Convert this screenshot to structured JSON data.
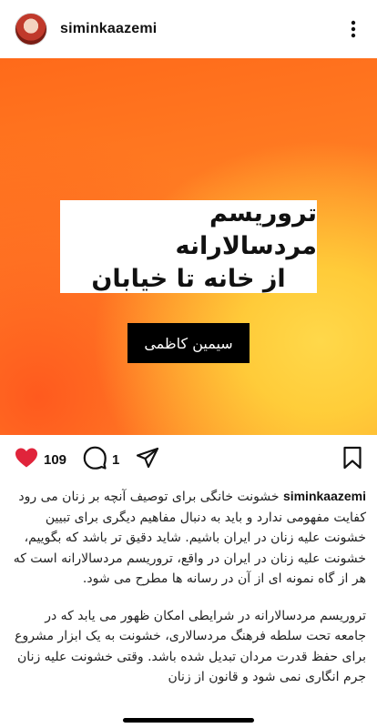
{
  "header": {
    "username": "siminkaazemi",
    "more_icon": "more-vertical-icon"
  },
  "post_image": {
    "title_line1": "تروریسم مردسالارانه",
    "title_line2": "از خانه تا خیابان",
    "author": "سیمین کاظمی"
  },
  "actions": {
    "likes": "109",
    "comments": "1",
    "icons": [
      "heart-icon",
      "comment-icon",
      "share-icon",
      "bookmark-icon"
    ],
    "heart_color": "#e0243b"
  },
  "caption": {
    "username": "siminkaazemi",
    "paragraph1_text": "خشونت خانگی برای توصیف آنچه بر زنان می رود کفایت مفهومی ندارد و باید به دنبال مفاهیم دیگری برای تبیین خشونت علیه زنان در ایران باشیم. شاید دقیق تر باشد که بگوییم، خشونت علیه زنان در ایران در واقع، تروریسم مردسالارانه است که هر از گاه نمونه ای از آن در رسانه ها مطرح می شود.",
    "paragraph2_text": "تروریسم مردسالارانه در شرایطی امکان ظهور می یابد که در جامعه تحت سلطه فرهنگ مردسالاری، خشونت به یک ابزار مشروع برای حفظ قدرت مردان تبدیل شده باشد. وقتی خشونت علیه زنان جرم انگاری نمی شود و قانون از زنان"
  }
}
